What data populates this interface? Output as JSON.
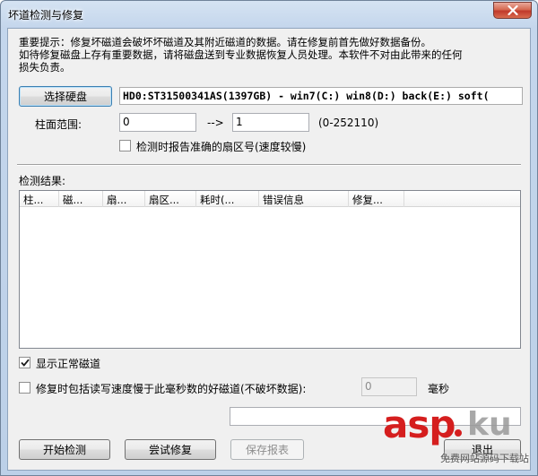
{
  "window": {
    "title": "坏道检测与修复"
  },
  "notice": {
    "line1": "重要提示：修复坏磁道会破坏坏磁道及其附近磁道的数据。请在修复前首先做好数据备份。",
    "line2": "如待修复磁盘上存有重要数据，请将磁盘送到专业数据恢复人员处理。本软件不对由此带来的任何",
    "line3": "损失负责。"
  },
  "disk": {
    "select_label": "选择硬盘",
    "selected": "HD0:ST31500341AS(1397GB) - win7(C:) win8(D:) back(E:) soft("
  },
  "cylinder": {
    "label": "柱面范围:",
    "from": "0",
    "arrow": "-->",
    "to": "1",
    "range_hint": "(0-252110)"
  },
  "options": {
    "report_sector_label": "检测时报告准确的扇区号(速度较慢)",
    "report_sector_checked": false,
    "show_normal_label": "显示正常磁道",
    "show_normal_checked": true,
    "slow_repair_label": "修复时包括读写速度慢于此毫秒数的好磁道(不破坏数据):",
    "slow_repair_checked": false,
    "slow_ms_value": "0",
    "ms_unit": "毫秒"
  },
  "results": {
    "label": "检测结果:",
    "columns": [
      "柱...",
      "磁...",
      "扇...",
      "扇区...",
      "耗时(...",
      "错误信息",
      "修复..."
    ]
  },
  "status_text": "",
  "buttons": {
    "start": "开始检测",
    "try_repair": "尝试修复",
    "save_report": "保存报表",
    "exit": "退出"
  },
  "watermark": {
    "brand": "asp",
    "suffix": "ku",
    "tagline": "免费网站源码下载站"
  },
  "colors": {
    "close_button": "#c0392b",
    "watermark_red": "#d51e1e"
  }
}
